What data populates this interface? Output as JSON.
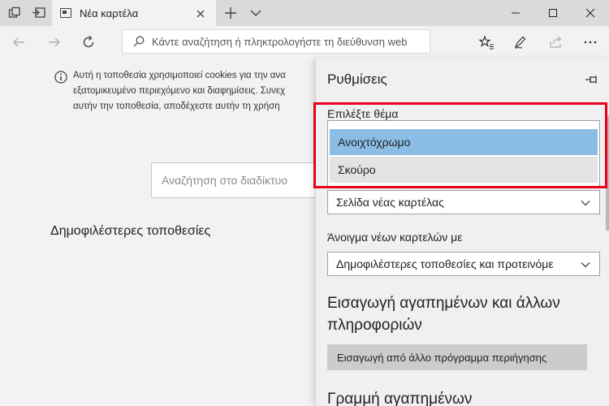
{
  "tab": {
    "title": "Νέα καρτέλα"
  },
  "address": {
    "placeholder": "Κάντε αναζήτηση ή πληκτρολογήστε τη διεύθυνση web"
  },
  "content": {
    "cookie_lines": [
      "Αυτή η τοποθεσία χρησιμοποιεί cookies για την ανα",
      "εξατομικευμένο περιεχόμενο και διαφημίσεις. Συνεχ",
      "αυτήν την τοποθεσία, αποδέχεστε αυτήν τη χρήση"
    ],
    "web_search_placeholder": "Αναζήτηση στο διαδίκτυο",
    "top_sites_heading": "Δημοφιλέστερες τοποθεσίες"
  },
  "settings": {
    "title": "Ρυθμίσεις",
    "theme_label": "Επιλέξτε θέμα",
    "theme_options": [
      "Ανοιχτόχρωμο",
      "Σκούρο"
    ],
    "open_with_value": "Σελίδα νέας καρτέλας",
    "new_tabs_label": "Άνοιγμα νέων καρτελών με",
    "new_tabs_value": "Δημοφιλέστερες τοποθεσίες και προτεινόμε",
    "import_heading_line1": "Εισαγωγή αγαπημένων και άλλων",
    "import_heading_line2": "πληροφοριών",
    "import_button": "Εισαγωγή από άλλο πρόγραμμα περιήγησης",
    "favorites_bar_heading": "Γραμμή αγαπημένων"
  },
  "colors": {
    "highlight": "#e8001c",
    "selected_option": "#8bbde6",
    "tab_bar": "#dadada"
  },
  "icons": {
    "tab_manager": "tabs-icon",
    "set_aside": "set-aside-icon",
    "favicon": "new-tab-favicon-icon",
    "close": "close-icon",
    "new_tab": "plus-icon",
    "tab_list": "chevron-down-icon",
    "back": "back-arrow-icon",
    "forward": "forward-arrow-icon",
    "refresh": "refresh-icon",
    "search": "search-icon",
    "favorites": "star-icon",
    "notes": "pen-icon",
    "share": "share-icon",
    "info": "info-icon",
    "pin": "pin-icon"
  }
}
